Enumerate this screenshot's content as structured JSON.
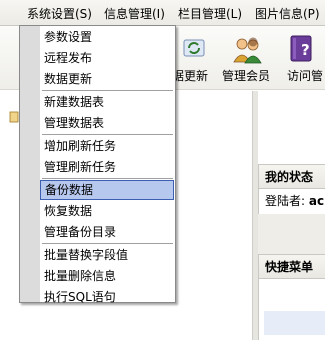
{
  "menubar": {
    "items": [
      {
        "label": "系统设置(S)"
      },
      {
        "label": "信息管理(I)"
      },
      {
        "label": "栏目管理(L)"
      },
      {
        "label": "图片信息(P)"
      }
    ]
  },
  "toolbar": {
    "items": [
      {
        "label": "据更新",
        "icon": "refresh-icon"
      },
      {
        "label": "管理会员",
        "icon": "users-icon"
      },
      {
        "label": "访问管",
        "icon": "book-icon"
      }
    ]
  },
  "dropdown": {
    "groups": [
      [
        "参数设置",
        "远程发布",
        "数据更新"
      ],
      [
        "新建数据表",
        "管理数据表"
      ],
      [
        "增加刷新任务",
        "管理刷新任务"
      ],
      [
        "备份数据",
        "恢复数据",
        "管理备份目录"
      ],
      [
        "批量替换字段值",
        "批量删除信息",
        "执行SQL语句"
      ]
    ],
    "selected": "备份数据"
  },
  "status_panel": {
    "title": "我的状态",
    "login_label": "登陆者:",
    "login_value": "ac"
  },
  "quick_panel": {
    "title": "快捷菜单"
  },
  "colors": {
    "selection_bg": "#b7c8ee",
    "selection_border": "#3c5fb2",
    "menu_gutter": "#dcdcdc"
  }
}
